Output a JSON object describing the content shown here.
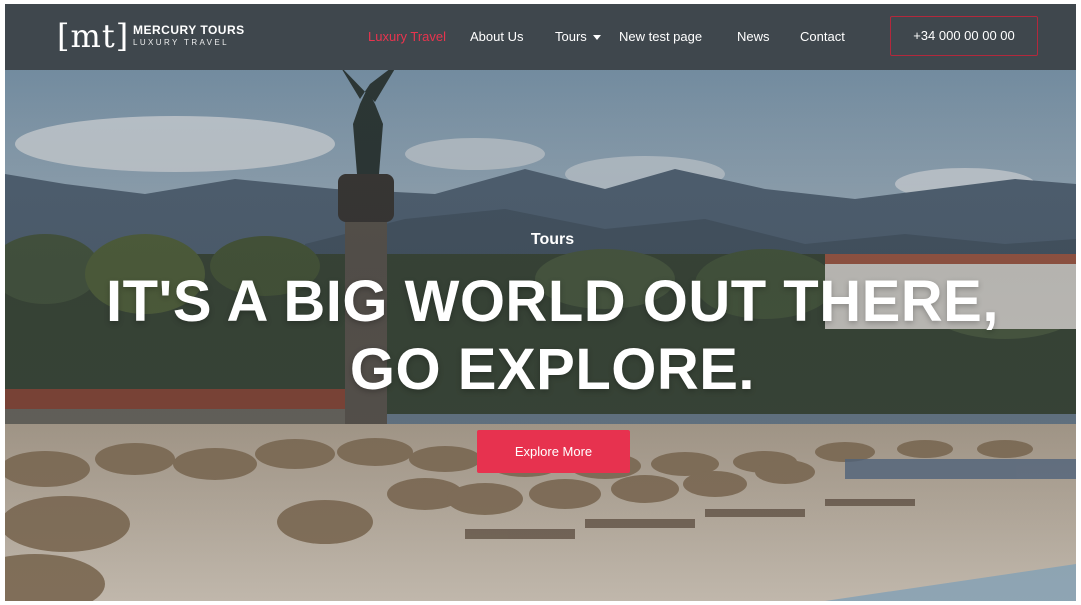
{
  "brand": {
    "logo_mark": "[mt]",
    "name": "MERCURY TOURS",
    "tagline": "LUXURY TRAVEL"
  },
  "nav": {
    "items": [
      {
        "label": "Luxury Travel",
        "active": true
      },
      {
        "label": "About Us",
        "active": false
      },
      {
        "label": "Tours",
        "active": false,
        "has_dropdown": true
      },
      {
        "label": "New test page",
        "active": false
      },
      {
        "label": "News",
        "active": false
      },
      {
        "label": "Contact",
        "active": false
      }
    ],
    "phone": "+34 000 00 00 00"
  },
  "hero": {
    "eyebrow": "Tours",
    "title_line1": "IT'S A BIG WORLD OUT THERE,",
    "title_line2": "GO EXPLORE.",
    "cta_label": "Explore More"
  },
  "colors": {
    "accent": "#e7324f",
    "navbar": "#3f474d",
    "text": "#ffffff"
  },
  "icons": {
    "dropdown": "caret-down-icon"
  }
}
